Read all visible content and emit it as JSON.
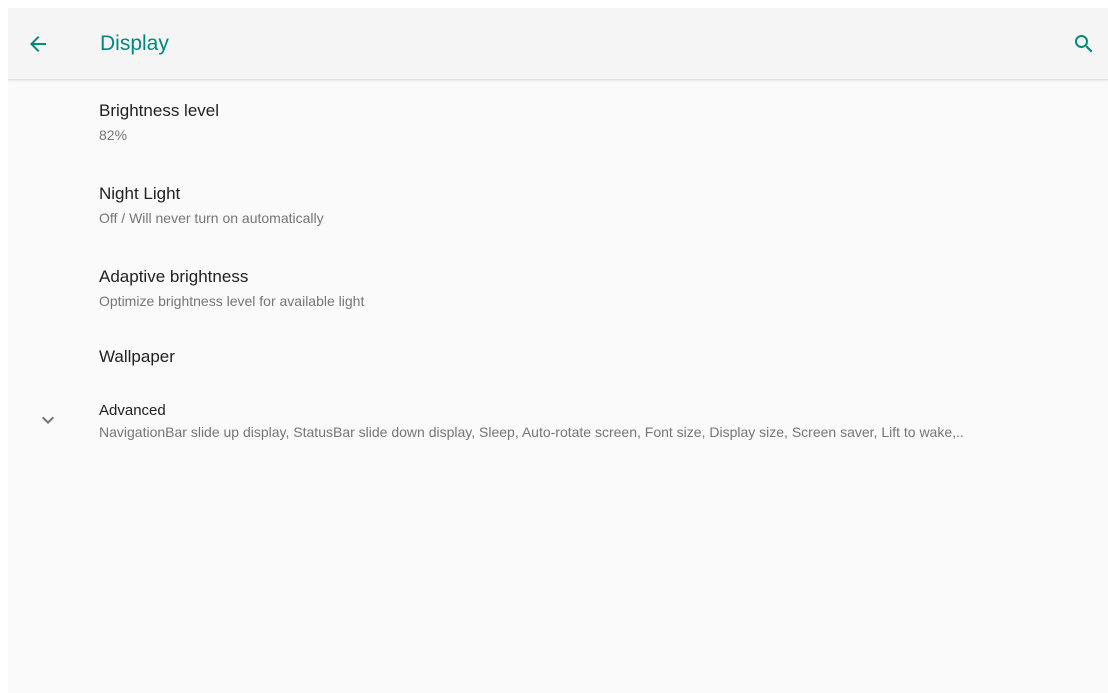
{
  "appbar": {
    "title": "Display",
    "back_icon": "arrow-back-icon",
    "search_icon": "search-icon"
  },
  "settings": [
    {
      "label": "Brightness level",
      "summary": "82%"
    },
    {
      "label": "Night Light",
      "summary": "Off / Will never turn on automatically"
    },
    {
      "label": "Adaptive brightness",
      "summary": "Optimize brightness level for available light"
    },
    {
      "label": "Wallpaper"
    }
  ],
  "advanced": {
    "label": "Advanced",
    "summary": "NavigationBar slide up display, StatusBar slide down display, Sleep, Auto-rotate screen, Font size, Display size, Screen saver, Lift to wake,..",
    "icon": "chevron-down-icon"
  },
  "colors": {
    "accent": "#00897b",
    "background": "#fafafa",
    "appbar": "#f5f5f5",
    "primary_text": "#212121",
    "secondary_text": "#757575"
  }
}
